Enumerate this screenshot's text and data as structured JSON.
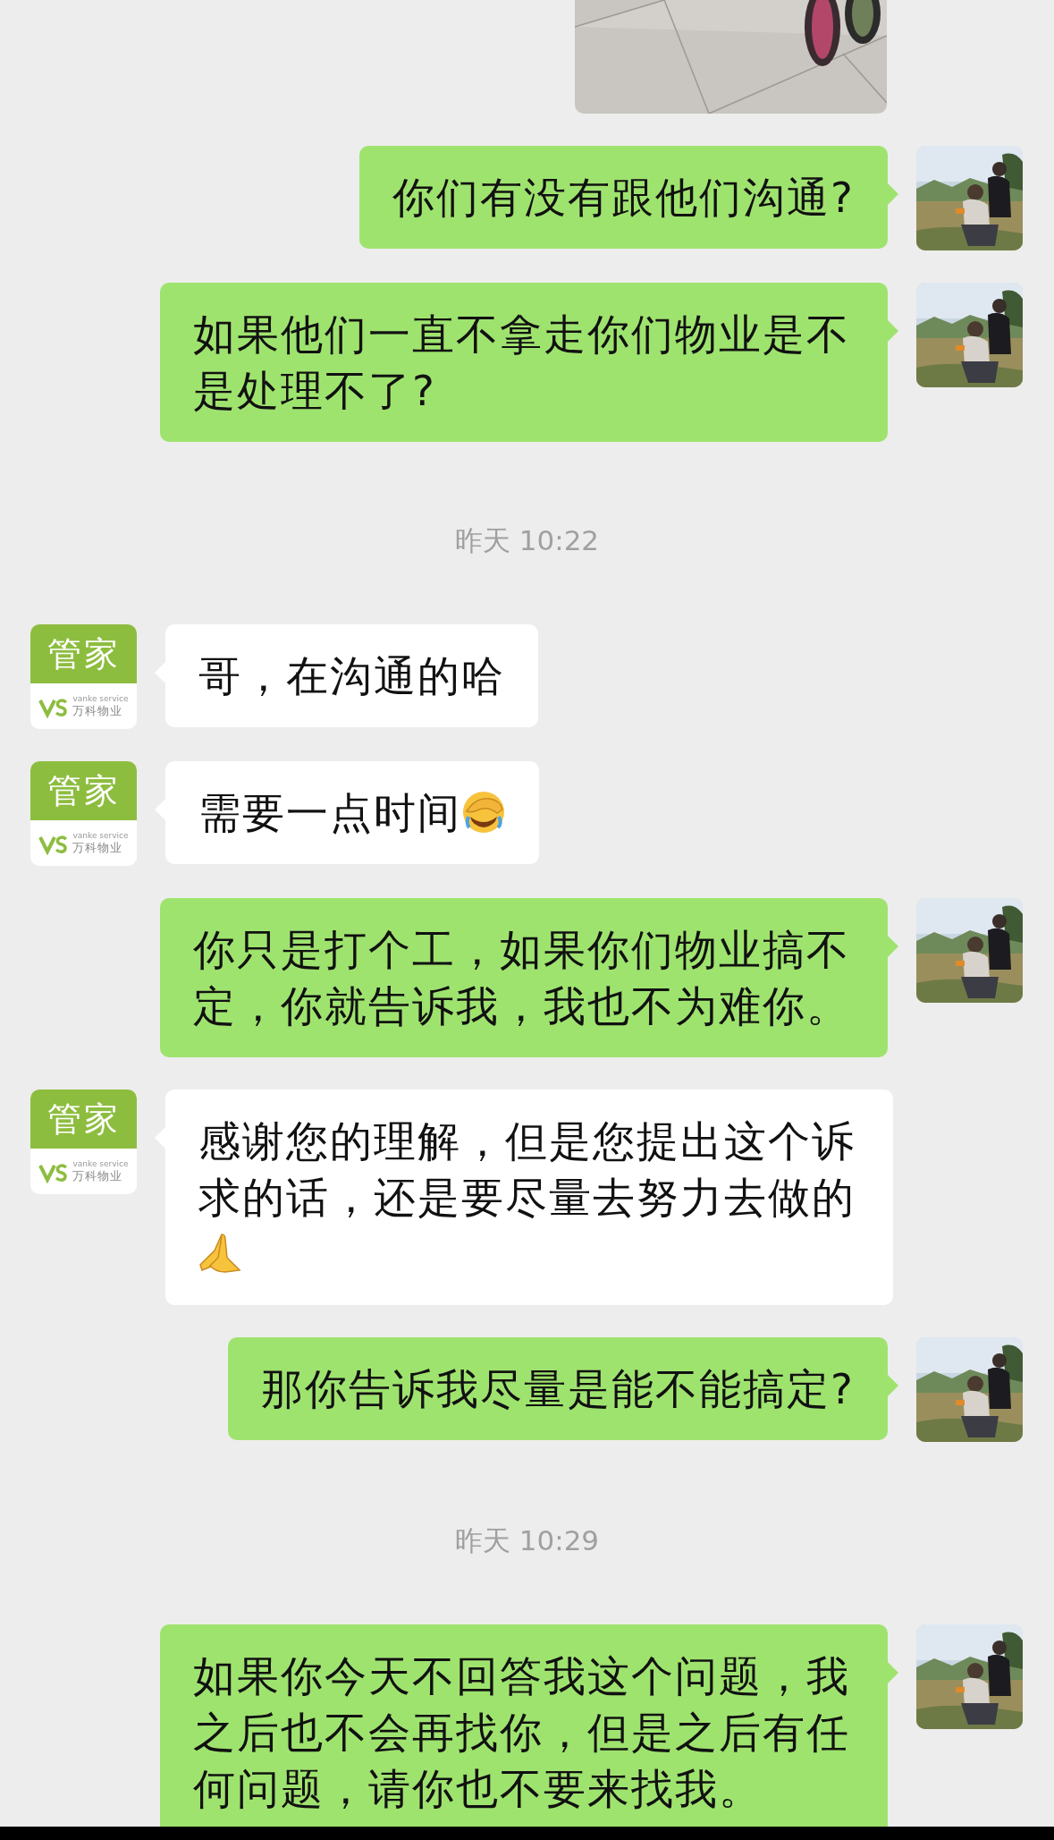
{
  "messages": [
    {
      "kind": "image_sent"
    },
    {
      "kind": "text_sent",
      "text": "你们有没有跟他们沟通?"
    },
    {
      "kind": "text_sent",
      "text": "如果他们一直不拿走你们物业是不是处理不了?"
    },
    {
      "kind": "time",
      "text": "昨天 10:22"
    },
    {
      "kind": "text_received",
      "text": "哥，在沟通的哈",
      "avatar": {
        "title": "管家",
        "brand_en": "vanke service",
        "brand_cn": "万科物业"
      }
    },
    {
      "kind": "text_received",
      "text": "需要一点时间",
      "emoji": {
        "kind": "facepalm"
      },
      "avatar": {
        "title": "管家",
        "brand_en": "vanke service",
        "brand_cn": "万科物业"
      }
    },
    {
      "kind": "text_sent",
      "text": "你只是打个工，如果你们物业搞不定，你就告诉我，我也不为难你。"
    },
    {
      "kind": "text_received",
      "text": "感谢您的理解，但是您提出这个诉求的话，还是要尽量去努力去做的",
      "emoji": {
        "kind": "pray"
      },
      "avatar": {
        "title": "管家",
        "brand_en": "vanke service",
        "brand_cn": "万科物业"
      }
    },
    {
      "kind": "text_sent",
      "text": "那你告诉我尽量是能不能搞定?"
    },
    {
      "kind": "time",
      "text": "昨天 10:29"
    },
    {
      "kind": "text_sent",
      "text": "如果你今天不回答我这个问题，我之后也不会再找你，但是之后有任何问题，请你也不要来找我。"
    }
  ]
}
